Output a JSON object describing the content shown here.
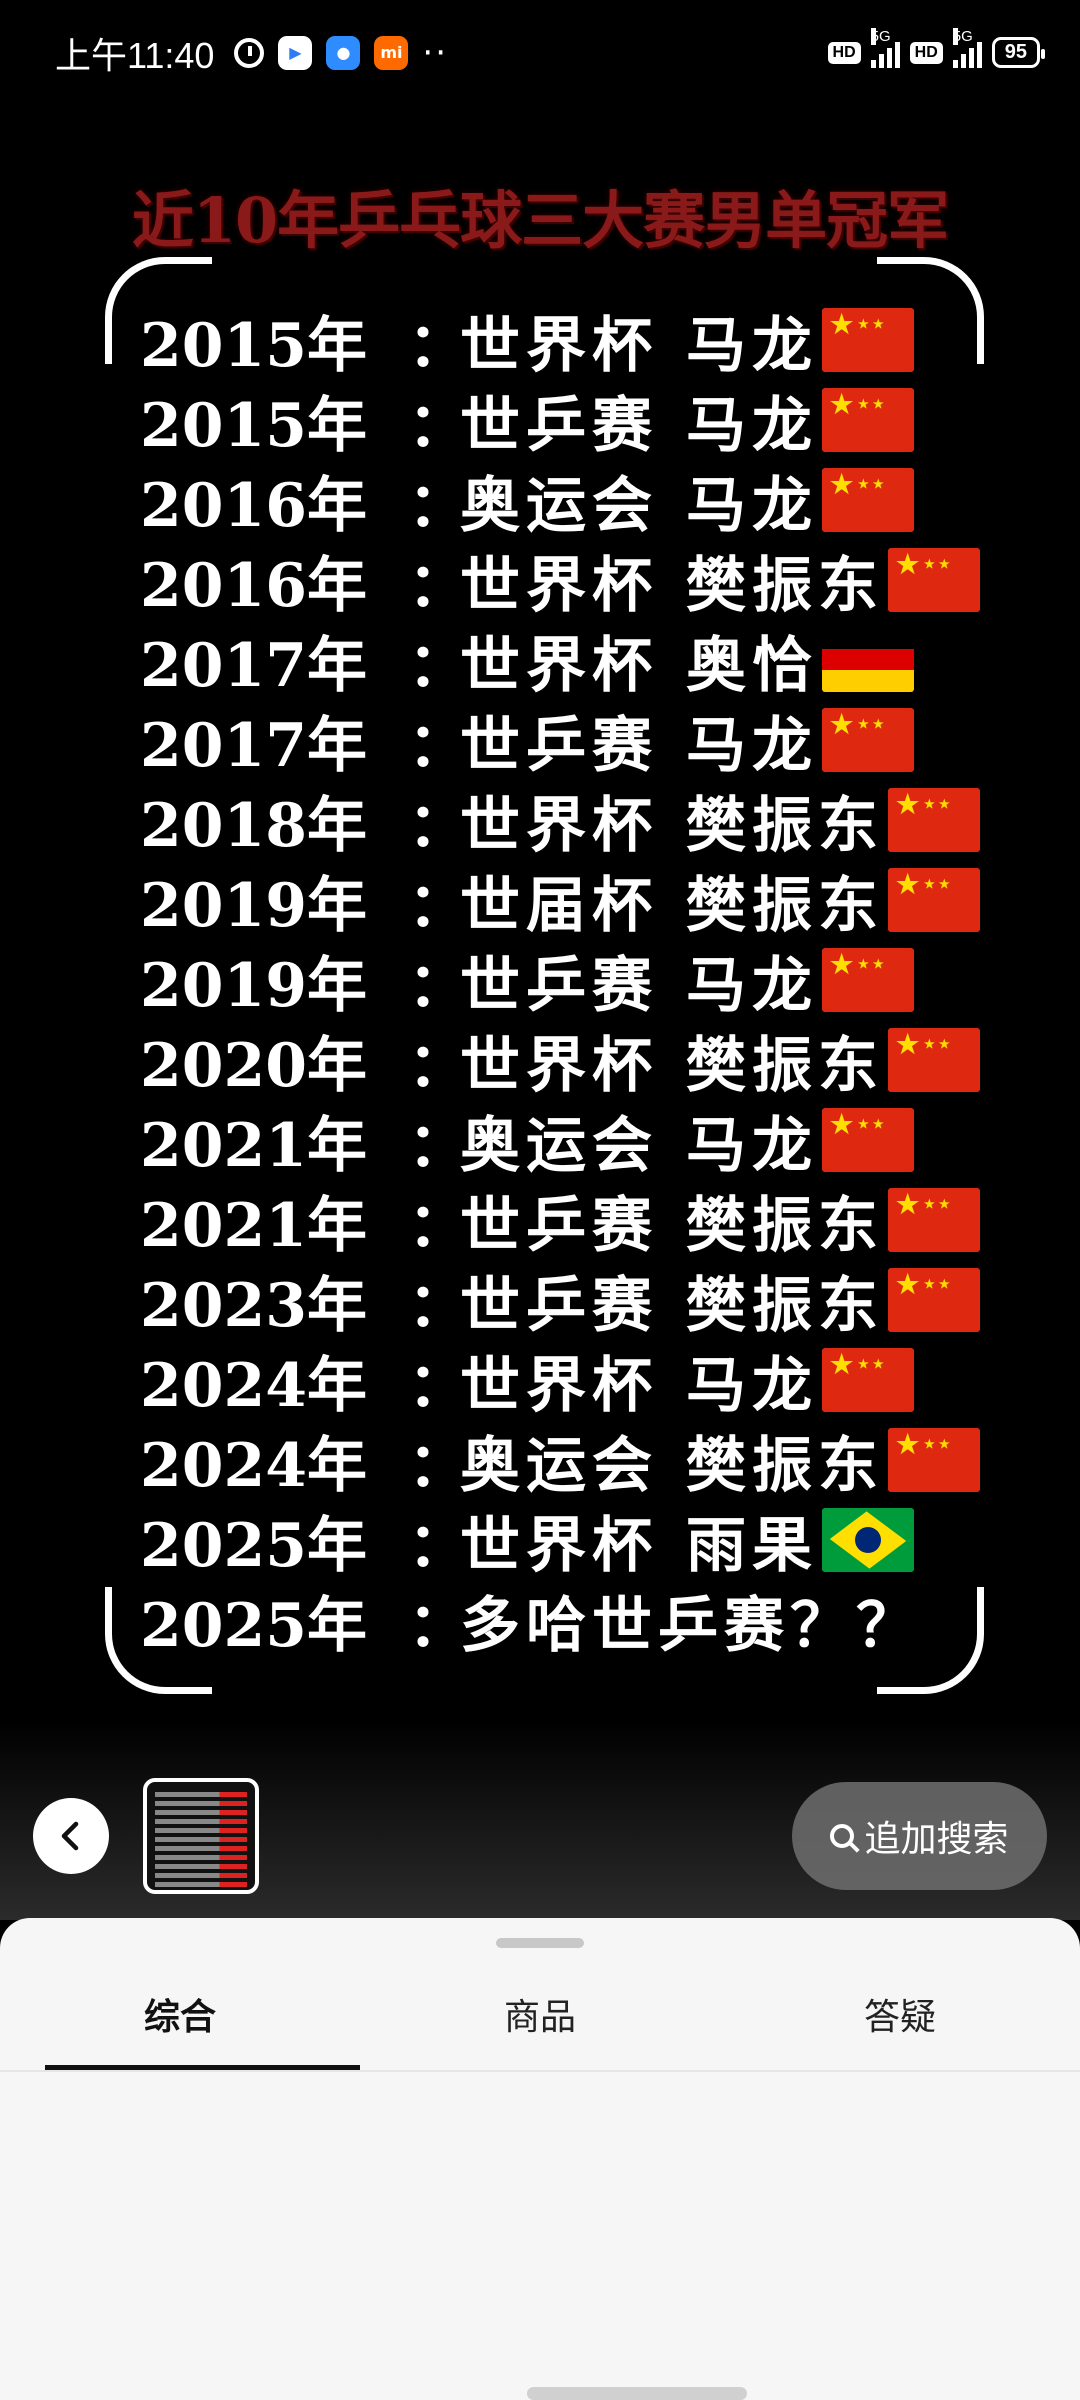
{
  "status_bar": {
    "time": "上午11:40",
    "app_icons": [
      "alarm-icon",
      "play-store-icon",
      "message-app-icon",
      "mi-app-icon"
    ],
    "more": "··",
    "hd_label": "HD",
    "network_label": "5G",
    "battery": "95"
  },
  "poster": {
    "title": "近10年乒乓球三大赛男单冠军",
    "rows": [
      {
        "year": "2015年",
        "colon": "：",
        "event": "世界杯",
        "name": "马龙",
        "flag": "cn"
      },
      {
        "year": "2015年",
        "colon": "：",
        "event": "世乒赛",
        "name": "马龙",
        "flag": "cn"
      },
      {
        "year": "2016年",
        "colon": "：",
        "event": "奥运会",
        "name": "马龙",
        "flag": "cn"
      },
      {
        "year": "2016年",
        "colon": "：",
        "event": "世界杯",
        "name": "樊振东",
        "flag": "cn"
      },
      {
        "year": "2017年",
        "colon": "：",
        "event": "世界杯",
        "name": "奥恰",
        "flag": "de"
      },
      {
        "year": "2017年",
        "colon": "：",
        "event": "世乒赛",
        "name": "马龙",
        "flag": "cn"
      },
      {
        "year": "2018年",
        "colon": "：",
        "event": "世界杯",
        "name": "樊振东",
        "flag": "cn"
      },
      {
        "year": "2019年",
        "colon": "：",
        "event": "世届杯",
        "name": "樊振东",
        "flag": "cn"
      },
      {
        "year": "2019年",
        "colon": "：",
        "event": "世乒赛",
        "name": "马龙",
        "flag": "cn"
      },
      {
        "year": "2020年",
        "colon": "：",
        "event": "世界杯",
        "name": "樊振东",
        "flag": "cn"
      },
      {
        "year": "2021年",
        "colon": "：",
        "event": "奥运会",
        "name": "马龙",
        "flag": "cn"
      },
      {
        "year": "2021年",
        "colon": "：",
        "event": "世乒赛",
        "name": "樊振东",
        "flag": "cn"
      },
      {
        "year": "2023年",
        "colon": "：",
        "event": "世乒赛",
        "name": "樊振东",
        "flag": "cn"
      },
      {
        "year": "2024年",
        "colon": "：",
        "event": "世界杯",
        "name": "马龙",
        "flag": "cn"
      },
      {
        "year": "2024年",
        "colon": "：",
        "event": "奥运会",
        "name": "樊振东",
        "flag": "cn"
      },
      {
        "year": "2025年",
        "colon": "：",
        "event": "世界杯",
        "name": "雨果",
        "flag": "br"
      },
      {
        "year": "2025年",
        "colon": "：",
        "event": "多哈世乒赛？？",
        "name": "",
        "flag": ""
      }
    ]
  },
  "controls": {
    "back_icon": "chevron-left-icon",
    "search_more_label": "追加搜索"
  },
  "sheet": {
    "tabs": [
      {
        "label": "综合",
        "active": true
      },
      {
        "label": "商品",
        "active": false
      },
      {
        "label": "答疑",
        "active": false
      }
    ]
  },
  "colors": {
    "title_red": "#8a1a1a",
    "sheet_bg": "#f6f6f6",
    "pill_bg": "#6e6e6e"
  }
}
